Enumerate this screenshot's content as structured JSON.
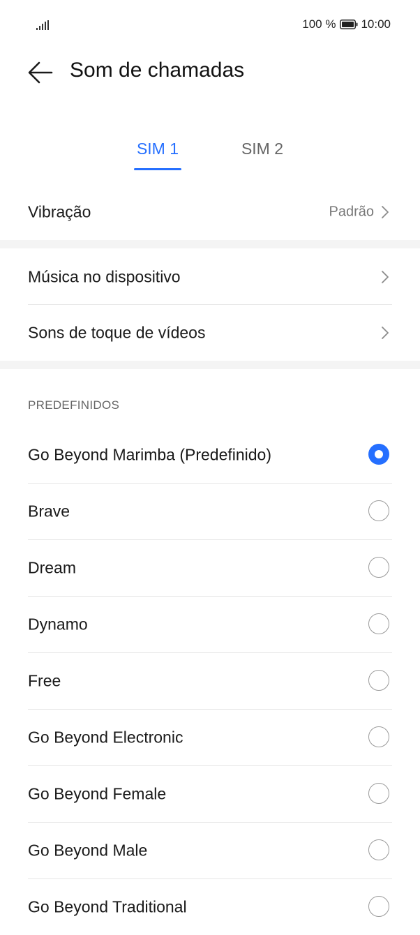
{
  "status": {
    "battery_text": "100 %",
    "time": "10:00",
    "signal_icon": "signal-icon",
    "battery_icon": "battery-icon"
  },
  "header": {
    "title": "Som de chamadas",
    "back_icon": "arrow-left-icon"
  },
  "tabs": [
    {
      "label": "SIM 1",
      "selected": true
    },
    {
      "label": "SIM 2",
      "selected": false
    }
  ],
  "vibration": {
    "label": "Vibração",
    "value": "Padrão"
  },
  "sources": [
    {
      "label": "Música no dispositivo"
    },
    {
      "label": "Sons de toque de vídeos"
    }
  ],
  "presets": {
    "title": "PREDEFINIDOS",
    "items": [
      {
        "label": "Go Beyond Marimba (Predefinido)",
        "selected": true
      },
      {
        "label": "Brave",
        "selected": false
      },
      {
        "label": "Dream",
        "selected": false
      },
      {
        "label": "Dynamo",
        "selected": false
      },
      {
        "label": "Free",
        "selected": false
      },
      {
        "label": "Go Beyond Electronic",
        "selected": false
      },
      {
        "label": "Go Beyond Female",
        "selected": false
      },
      {
        "label": "Go Beyond Male",
        "selected": false
      },
      {
        "label": "Go Beyond Traditional",
        "selected": false
      }
    ]
  },
  "colors": {
    "accent": "#256FFF",
    "band": "#F4F4F4",
    "divider": "#E6E6E6"
  }
}
